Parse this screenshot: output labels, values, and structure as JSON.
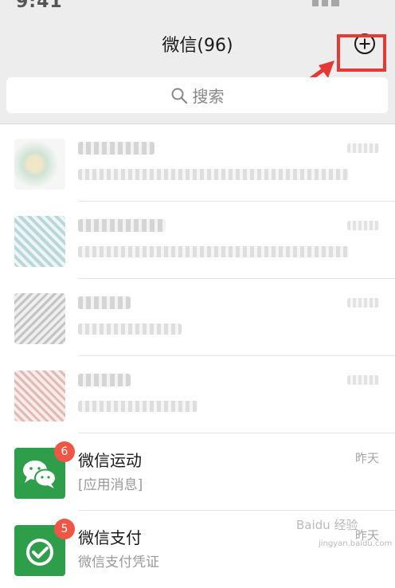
{
  "status_bar": {
    "time": "9:41"
  },
  "header": {
    "title": "微信(96)",
    "add_icon": "plus-circle-icon"
  },
  "annotation": {
    "highlight_color": "#e53935"
  },
  "search": {
    "label": "搜索",
    "icon": "search-icon"
  },
  "chats": [
    {
      "name": "",
      "preview": "",
      "time": "",
      "blurred": true
    },
    {
      "name": "",
      "preview": "",
      "time": "",
      "blurred": true
    },
    {
      "name": "",
      "preview": "",
      "time": "",
      "blurred": true
    },
    {
      "name": "",
      "preview": "",
      "time": "",
      "blurred": true
    },
    {
      "name": "微信运动",
      "preview": "[应用消息]",
      "time": "昨天",
      "badge": "6",
      "icon": "wechat-sport-icon"
    },
    {
      "name": "微信支付",
      "preview": "微信支付凭证",
      "time": "昨天",
      "badge": "5",
      "icon": "wechat-pay-icon"
    }
  ],
  "watermark": {
    "text": "Baidu 经验",
    "sub": "jingyan.baidu.com"
  },
  "colors": {
    "accent_green": "#2f9e4b",
    "badge_red": "#f05545",
    "background": "#ededed"
  }
}
